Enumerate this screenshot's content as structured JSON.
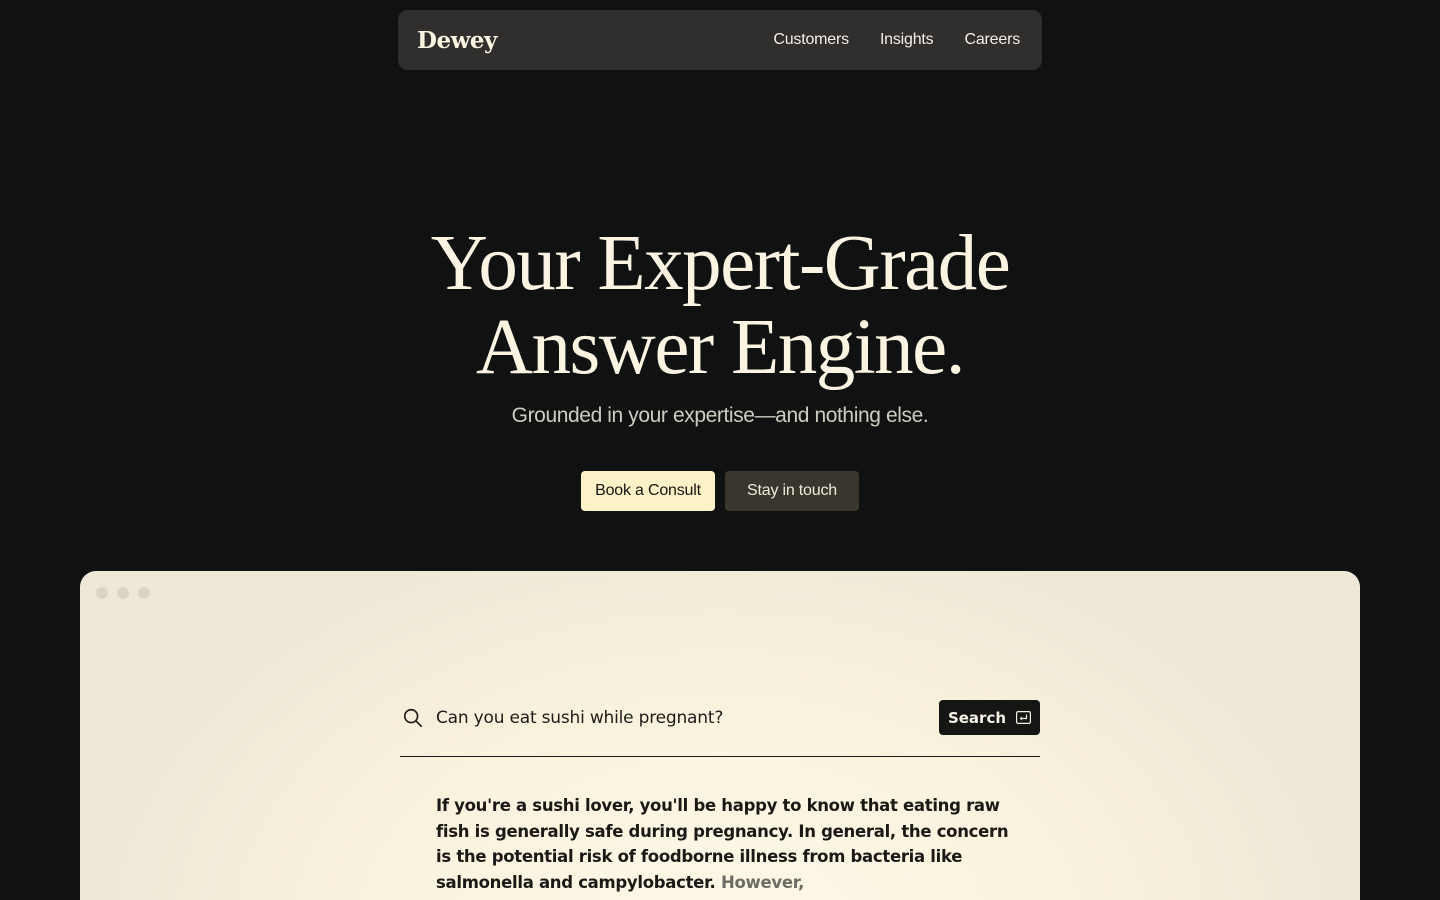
{
  "nav": {
    "logo": "Dewey",
    "links": [
      "Customers",
      "Insights",
      "Careers"
    ]
  },
  "hero": {
    "title_line1": "Your Expert-Grade",
    "title_line2": "Answer Engine.",
    "subtitle": "Grounded in your expertise—and nothing else.",
    "primary_cta": "Book a Consult",
    "secondary_cta": "Stay in touch"
  },
  "demo": {
    "search_query": "Can you eat sushi while pregnant?",
    "search_button": "Search",
    "answer_text": "If you're a sushi lover, you'll be happy to know that eating raw fish is generally safe during pregnancy. In general, the concern is the potential risk of foodborne illness from bacteria like salmonella and campylobacter. ",
    "answer_fade": "However,"
  },
  "colors": {
    "background": "#101211",
    "nav_bg": "#302f2d",
    "primary_button": "#fdf1c7",
    "secondary_button": "#38362d",
    "window_bg": "#f9f2dd",
    "search_button": "#151513"
  },
  "icons": {
    "search": "search-icon",
    "enter": "enter-key-icon"
  }
}
